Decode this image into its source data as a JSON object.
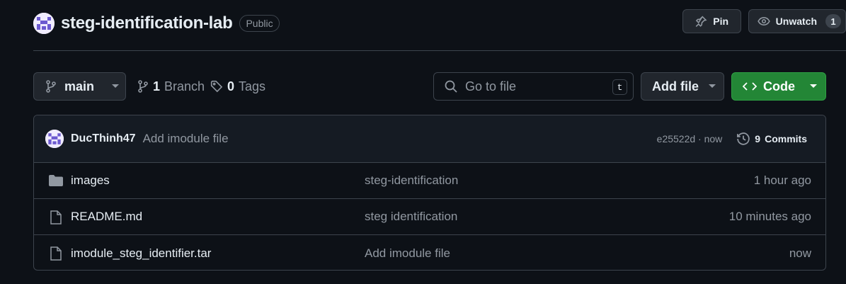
{
  "header": {
    "repo_name": "steg-identification-lab",
    "visibility": "Public",
    "pin_label": "Pin",
    "watch_label": "Unwatch",
    "watch_count": "1"
  },
  "toolbar": {
    "branch": "main",
    "branches_count": "1",
    "branches_label": "Branch",
    "tags_count": "0",
    "tags_label": "Tags",
    "search_placeholder": "Go to file",
    "search_shortcut": "t",
    "add_file_label": "Add file",
    "code_label": "Code"
  },
  "latest_commit": {
    "author": "DucThinh47",
    "message": "Add imodule file",
    "sha_time": "e25522d · now",
    "commits_count": "9",
    "commits_label": "Commits"
  },
  "files": [
    {
      "name": "images",
      "type": "folder-icon",
      "commit": "steg-identification",
      "time": "1 hour ago"
    },
    {
      "name": "README.md",
      "type": "file-icon",
      "commit": "steg identification",
      "time": "10 minutes ago"
    },
    {
      "name": "imodule_steg_identifier.tar",
      "type": "file-icon",
      "commit": "Add imodule file",
      "time": "now"
    }
  ],
  "colors": {
    "background": "#0d1117",
    "border": "#3d444d",
    "code_button": "#238636",
    "muted_text": "#9198a1"
  }
}
